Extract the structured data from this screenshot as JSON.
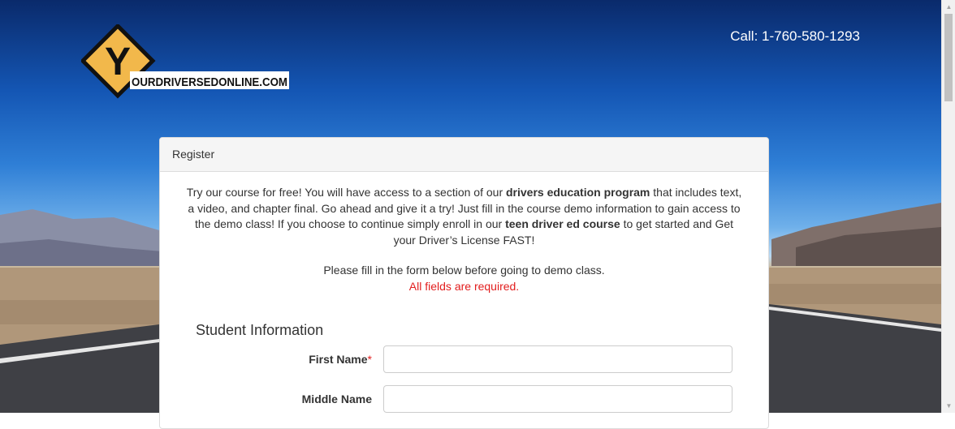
{
  "header": {
    "logo_alt": "YourDriversEdOnline.com",
    "logo_text": "OURDRIVERSEDONLINE.COM",
    "logo_letter": "Y",
    "phone": "Call: 1-760-580-1293"
  },
  "panel": {
    "title": "Register",
    "intro": {
      "p1": "Try our course for free! You will have access to a section of our ",
      "b1": "drivers education program",
      "p2": " that includes text, a video, and chapter final. Go ahead and give it a try! Just fill in the course demo information to gain access to the demo class! If you choose to continue simply enroll in our ",
      "b2": "teen driver ed course",
      "p3": " to get started and Get your Driver’s License FAST!"
    },
    "notice": "Please fill in the form below before going to demo class.",
    "required_note": "All fields are required.",
    "section_title": "Student Information",
    "fields": [
      {
        "label": "First Name",
        "required_marker": "*",
        "value": "",
        "placeholder": ""
      },
      {
        "label": "Middle Name",
        "required_marker": "",
        "value": "",
        "placeholder": ""
      }
    ]
  },
  "colors": {
    "required": "#e21d1d",
    "panel_header_bg": "#f5f5f5",
    "logo_yellow": "#f2b84b"
  }
}
